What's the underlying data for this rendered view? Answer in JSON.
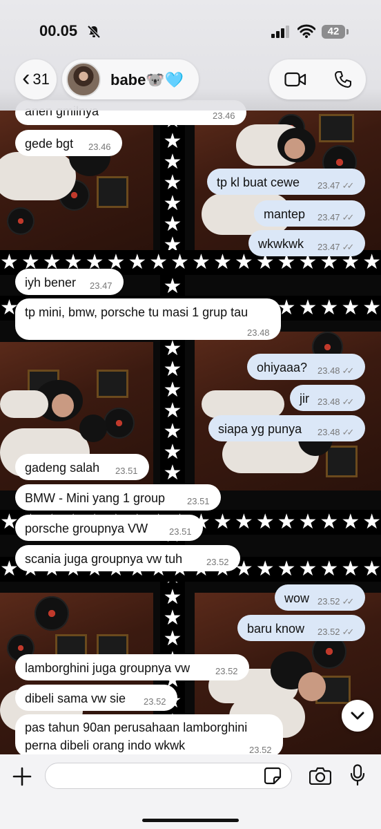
{
  "status_bar": {
    "time": "00.05",
    "battery": "42"
  },
  "header": {
    "back_count": "31",
    "contact_name": "babe🐨🩵"
  },
  "messages": [
    {
      "dir": "in",
      "text": "anen gmilnya",
      "time": "23.46"
    },
    {
      "dir": "in",
      "text": "gede bgt",
      "time": "23.46"
    },
    {
      "dir": "out",
      "text": "tp kl buat cewe",
      "time": "23.47"
    },
    {
      "dir": "out",
      "text": "mantep",
      "time": "23.47"
    },
    {
      "dir": "out",
      "text": "wkwkwk",
      "time": "23.47"
    },
    {
      "dir": "in",
      "text": "iyh bener",
      "time": "23.47"
    },
    {
      "dir": "in",
      "text": "tp mini, bmw, porsche tu masi 1 grup tau",
      "time": "23.48"
    },
    {
      "dir": "out",
      "text": "ohiyaaa?",
      "time": "23.48"
    },
    {
      "dir": "out",
      "text": "jir",
      "time": "23.48"
    },
    {
      "dir": "out",
      "text": "siapa yg punya",
      "time": "23.48"
    },
    {
      "dir": "in",
      "text": "gadeng salah",
      "time": "23.51"
    },
    {
      "dir": "in",
      "text": "BMW - Mini yang 1 group",
      "time": "23.51"
    },
    {
      "dir": "in",
      "text": "porsche groupnya VW",
      "time": "23.51"
    },
    {
      "dir": "in",
      "text": "scania juga groupnya vw tuh",
      "time": "23.52"
    },
    {
      "dir": "out",
      "text": "wow",
      "time": "23.52"
    },
    {
      "dir": "out",
      "text": "baru know",
      "time": "23.52"
    },
    {
      "dir": "in",
      "text": "lamborghini juga groupnya vw",
      "time": "23.52"
    },
    {
      "dir": "in",
      "text": "dibeli sama vw sie",
      "time": "23.52"
    },
    {
      "dir": "in",
      "text": "pas tahun 90an perusahaan lamborghini perna dibeli orang indo wkwk",
      "time": "23.52"
    }
  ],
  "read_tick": "✓✓",
  "icons": {
    "back": "chevron-left-icon",
    "video": "video-camera-icon",
    "phone": "phone-icon",
    "mute": "bell-slash-icon",
    "scroll": "chevron-down-icon",
    "plus": "plus-icon",
    "sticker": "sticker-icon",
    "camera": "camera-icon",
    "mic": "microphone-icon"
  },
  "colors": {
    "incoming": "#ffffff",
    "outgoing": "#dbe7f7",
    "header_bg": "#e6e6ea"
  }
}
